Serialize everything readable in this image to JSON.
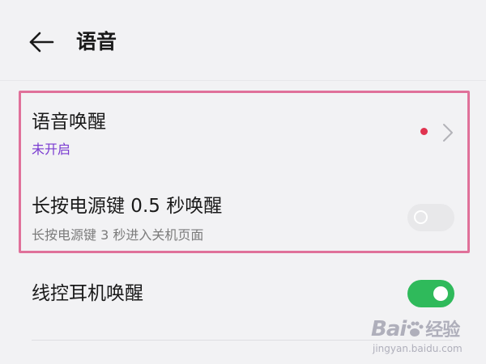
{
  "header": {
    "back_icon": "arrow-left-icon",
    "title": "语音"
  },
  "settings": {
    "voice_wakeup": {
      "title": "语音唤醒",
      "status": "未开启",
      "badge_color": "#e0334f",
      "chevron_icon": "chevron-right-icon"
    },
    "power_key_wakeup": {
      "title": "长按电源键 0.5 秒唤醒",
      "subtitle": "长按电源键 3 秒进入关机页面",
      "enabled": false
    },
    "headset_wakeup": {
      "title": "线控耳机唤醒",
      "enabled": true
    }
  },
  "colors": {
    "background": "#f2f2f4",
    "accent_purple": "#7a3bd0",
    "toggle_on": "#2fba5b",
    "toggle_off": "#e8e8ea",
    "highlight_border": "#e0719a"
  },
  "watermark": {
    "logo": "Bai",
    "logo_suffix": "经验",
    "url": "jingyan.baidu.com"
  }
}
